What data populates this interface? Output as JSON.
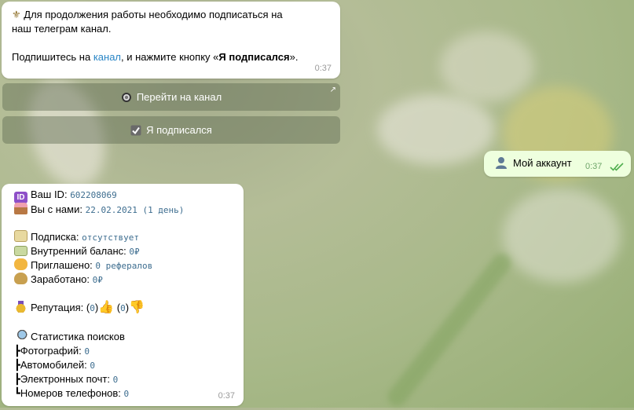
{
  "bot_message": {
    "line1": "Для продолжения работы необходимо подписаться на",
    "line2": "наш телеграм канал.",
    "line3_prefix": "Подпишитесь на ",
    "line3_link": "канал",
    "line3_middle": ", и нажмите кнопку «",
    "line3_bold": "Я подписался",
    "line3_suffix": "».",
    "time": "0:37"
  },
  "inline_buttons": [
    {
      "label": "Перейти на канал",
      "icon": "radio-button-icon"
    },
    {
      "label": "Я подписался",
      "icon": "check-box-icon"
    }
  ],
  "user_message": {
    "text": "Мой аккаунт",
    "time": "0:37"
  },
  "account": {
    "id_label": "Ваш ID:",
    "id_value": "602208069",
    "since_label": "Вы с нами:",
    "since_value": "22.02.2021 (1 день)",
    "sub_label": "Подписка:",
    "sub_value": "отсутствует",
    "balance_label": "Внутренний баланс:",
    "balance_value": "0₽",
    "invited_label": "Приглашено:",
    "invited_value": "0 рефералов",
    "earned_label": "Заработано:",
    "earned_value": "0₽",
    "rep_label": "Репутация:",
    "rep_up_open": "(",
    "rep_up_value": "0",
    "rep_up_close": ")",
    "rep_down_open": " (",
    "rep_down_value": "0",
    "rep_down_close": ")",
    "stats_title": "Статистика поисков",
    "stats": [
      {
        "prefix": "┣",
        "label": "Фотографий:",
        "value": "0"
      },
      {
        "prefix": "┣",
        "label": "Автомобилей:",
        "value": "0"
      },
      {
        "prefix": "┣",
        "label": "Электронных почт:",
        "value": "0"
      },
      {
        "prefix": "┗",
        "label": "Номеров телефонов:",
        "value": "0"
      }
    ],
    "time": "0:37"
  },
  "colors": {
    "link": "#2a86c6",
    "outgoing_bubble": "#eeffde",
    "check": "#4fae4e"
  }
}
